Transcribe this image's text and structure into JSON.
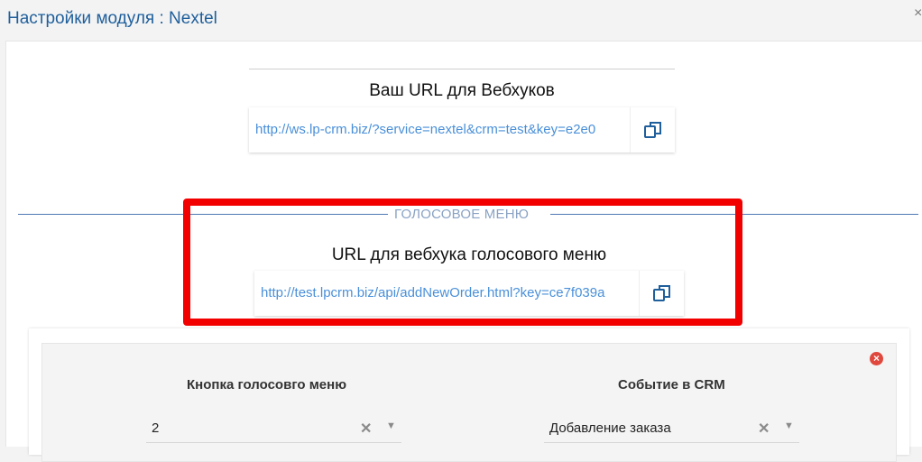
{
  "header": {
    "title": "Настройки модуля : Nextel",
    "close_glyph": "×"
  },
  "webhook": {
    "heading": "Ваш URL для Вебхуков",
    "url": "http://ws.lp-crm.biz/?service=nextel&crm=test&key=e2e0"
  },
  "voice_menu": {
    "section_label": "ГОЛОСОВОЕ МЕНЮ",
    "heading": "URL для вебхука голосового меню",
    "url": "http://test.lpcrm.biz/api/addNewOrder.html?key=ce7f039a"
  },
  "mapping": {
    "col1_label": "Кнопка голосовго меню",
    "col2_label": "Событие в CRM",
    "button_value": "2",
    "event_value": "Добавление заказа",
    "remove_glyph": "×",
    "clear_glyph": "✕",
    "caret_glyph": "▼"
  },
  "colors": {
    "title": "#1f5f9c",
    "link": "#4a90d9",
    "highlight": "#f20000",
    "section_line": "#4f79b4",
    "remove": "#e0483d"
  },
  "icons": {
    "copy": "copy-icon",
    "remove": "remove-circle-icon",
    "clear": "clear-icon",
    "caret": "chevron-down-icon"
  }
}
